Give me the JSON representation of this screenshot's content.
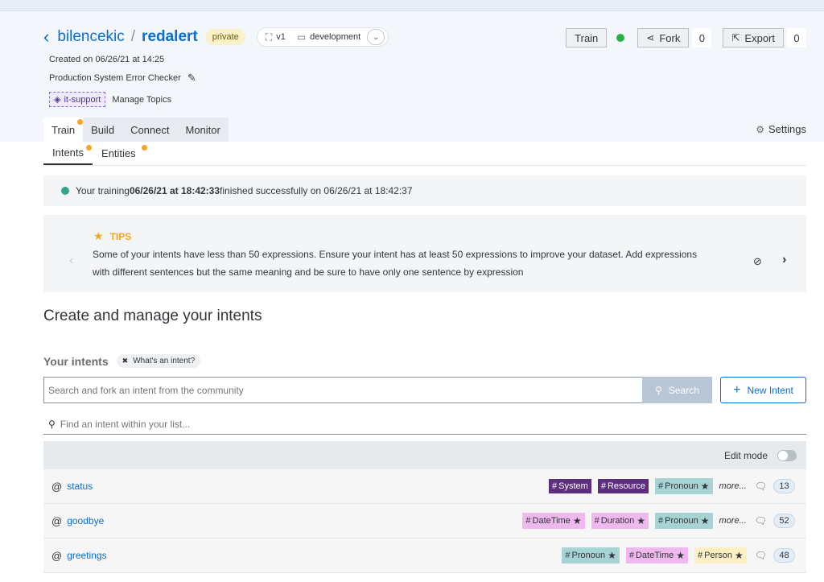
{
  "header": {
    "owner": "bilencekic",
    "separator": "/",
    "repo": "redalert",
    "visibility": "private",
    "version": "v1",
    "environment": "development",
    "created": "Created on 06/26/21 at 14:25",
    "description": "Production System Error Checker",
    "topic": "it-support",
    "manage_topics": "Manage Topics"
  },
  "actions": {
    "train_label": "Train",
    "fork_label": "Fork",
    "fork_count": "0",
    "export_label": "Export",
    "export_count": "0",
    "train_status_color": "#2bb049"
  },
  "tabs": [
    {
      "label": "Train",
      "active": true,
      "notification": true
    },
    {
      "label": "Build"
    },
    {
      "label": "Connect"
    },
    {
      "label": "Monitor"
    }
  ],
  "settings_label": "Settings",
  "subtabs": [
    {
      "label": "Intents",
      "active": true,
      "notification": true
    },
    {
      "label": "Entities",
      "notification": true
    }
  ],
  "training_banner": {
    "prefix": "Your training ",
    "bold": "06/26/21 at 18:42:33",
    "suffix": " finished successfully on 06/26/21 at 18:42:37"
  },
  "tips": {
    "title": "TIPS",
    "text": "Some of your intents have less than 50 expressions. Ensure your intent has at least 50 expressions to improve your dataset. Add expressions with different sentences but the same meaning and be sure to have only one sentence by expression"
  },
  "main": {
    "title": "Create and manage your intents",
    "your_intents": "Your intents",
    "whats_an_intent": "What's an intent?",
    "search_placeholder": "Search and fork an intent from the community",
    "search_button": "Search",
    "new_intent_button": "New Intent",
    "find_placeholder": "Find an intent within your list...",
    "edit_mode_label": "Edit mode",
    "more_label": "more..."
  },
  "intents": [
    {
      "name": "status",
      "count": "13",
      "entities": [
        {
          "label": "System",
          "kind": "system",
          "star": false
        },
        {
          "label": "Resource",
          "kind": "resource",
          "star": false
        },
        {
          "label": "Pronoun",
          "kind": "pronoun",
          "star": true
        }
      ]
    },
    {
      "name": "goodbye",
      "count": "52",
      "entities": [
        {
          "label": "DateTime",
          "kind": "datetime",
          "star": true
        },
        {
          "label": "Duration",
          "kind": "duration",
          "star": true
        },
        {
          "label": "Pronoun",
          "kind": "pronoun",
          "star": true
        }
      ]
    },
    {
      "name": "greetings",
      "count": "48",
      "entities": [
        {
          "label": "Pronoun",
          "kind": "pronoun",
          "star": true
        },
        {
          "label": "DateTime",
          "kind": "datetime",
          "star": true
        },
        {
          "label": "Person",
          "kind": "person",
          "star": true
        }
      ]
    }
  ]
}
